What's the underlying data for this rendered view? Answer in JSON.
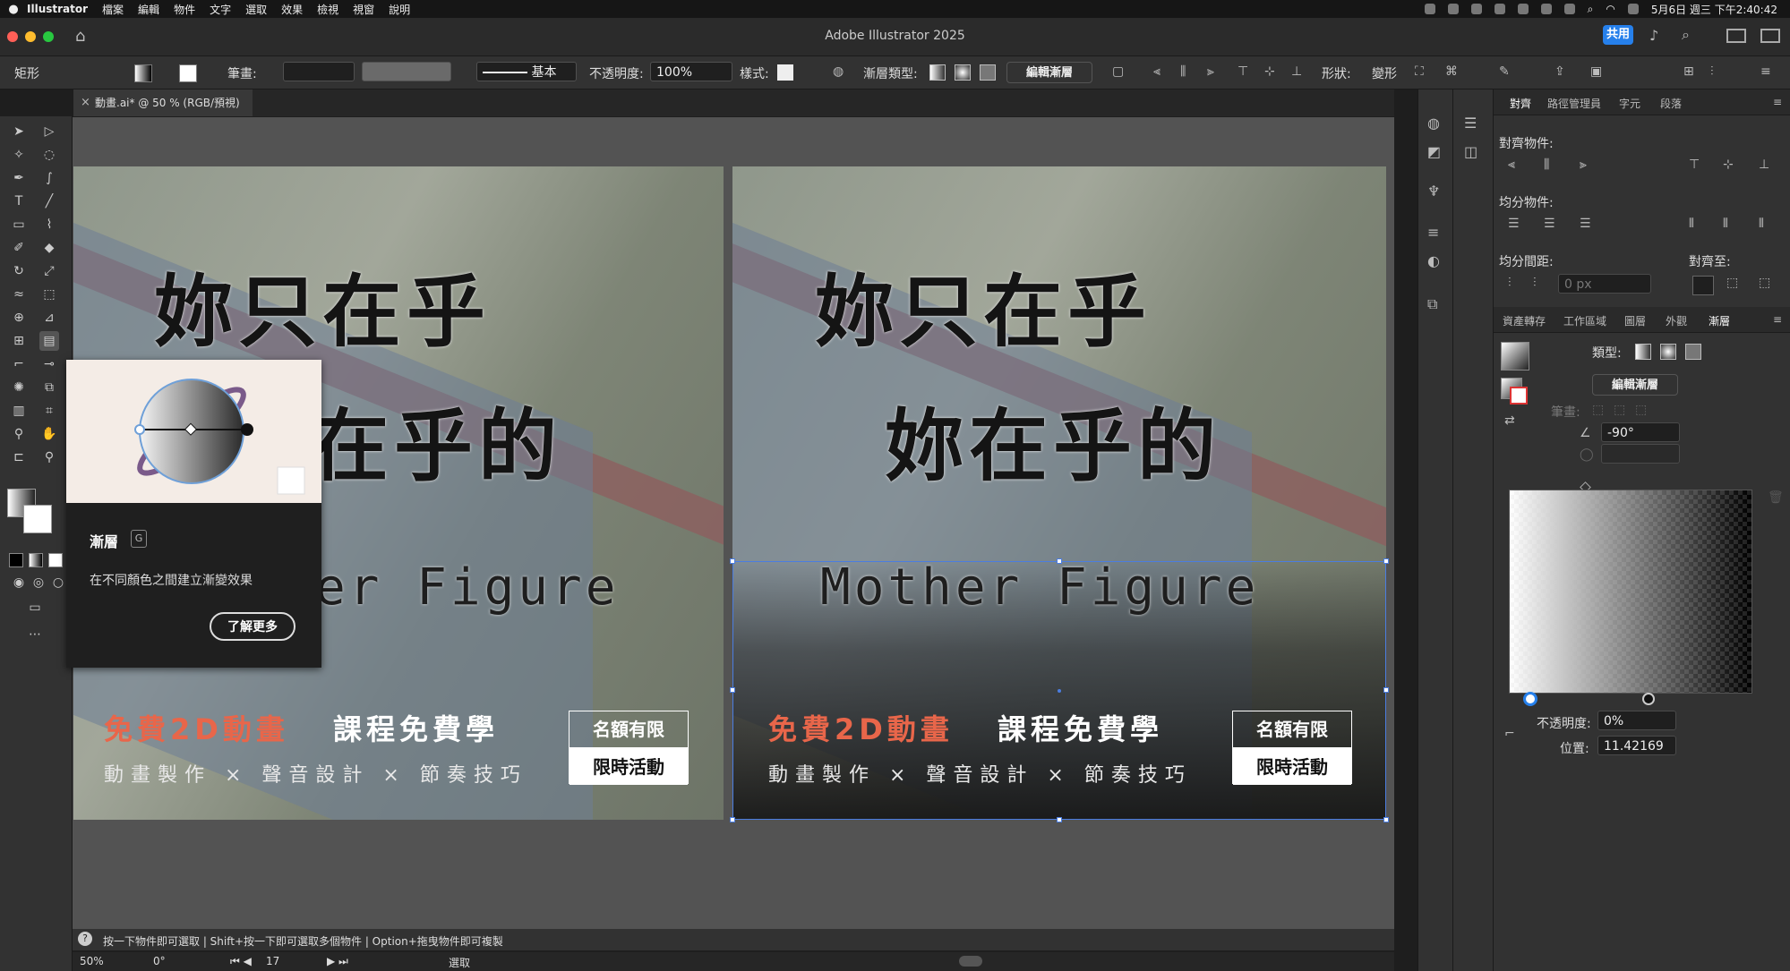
{
  "menubar": {
    "app": "Illustrator",
    "items": [
      "檔案",
      "編輯",
      "物件",
      "文字",
      "選取",
      "效果",
      "檢視",
      "視窗",
      "說明"
    ],
    "clock": "5月6日 週三 下午2:40:42"
  },
  "window": {
    "title": "Adobe Illustrator 2025",
    "share_label": "共用"
  },
  "control_bar": {
    "selection_label": "矩形",
    "stroke_label": "筆畫:",
    "stroke_style": "基本",
    "opacity_label": "不透明度:",
    "opacity_value": "100%",
    "style_label": "樣式:",
    "gradient_type_label": "漸層類型:",
    "edit_gradient_label": "編輯漸層",
    "shape_label": "形狀:",
    "transform_label": "變形"
  },
  "document_tab": {
    "title": "動畫.ai* @ 50 % (RGB/預視)"
  },
  "artwork": {
    "line1": "妳只在乎",
    "line2": "妳在乎的",
    "english_left": "er Figure",
    "english_right": "Mother Figure",
    "promo_red": "免費2D動畫",
    "promo_white": "課程免費學",
    "promo_sub": "動畫製作 × 聲音設計 × 節奏技巧",
    "badge_top": "名額有限",
    "badge_bottom": "限時活動"
  },
  "tooltip": {
    "title": "漸層",
    "shortcut": "G",
    "description": "在不同顏色之間建立漸變效果",
    "learn_more": "了解更多"
  },
  "panel_top": {
    "tabs": [
      "對齊",
      "路徑管理員",
      "字元",
      "段落"
    ],
    "align_objects": "對齊物件:",
    "distribute_objects": "均分物件:",
    "distribute_spacing": "均分間距:",
    "align_to": "對齊至:",
    "spacing_value": "0 px"
  },
  "panel_gradient": {
    "tabs": [
      "資產轉存",
      "工作區域",
      "圖層",
      "外觀",
      "漸層"
    ],
    "type_label": "類型:",
    "edit_gradient": "編輯漸層",
    "stroke_label": "筆畫:",
    "angle_value": "-90°",
    "opacity_label": "不透明度:",
    "opacity_value": "0%",
    "location_label": "位置:",
    "location_value": "11.42169"
  },
  "status": {
    "hint": "按一下物件即可選取 | Shift+按一下即可選取多個物件 | Option+拖曳物件即可複製",
    "zoom": "50%",
    "rotation": "0°",
    "artboard": "17",
    "mode": "選取"
  },
  "colors": {
    "accent": "#2680eb",
    "selection": "#4b7de0",
    "promo_red": "#e8664a"
  }
}
